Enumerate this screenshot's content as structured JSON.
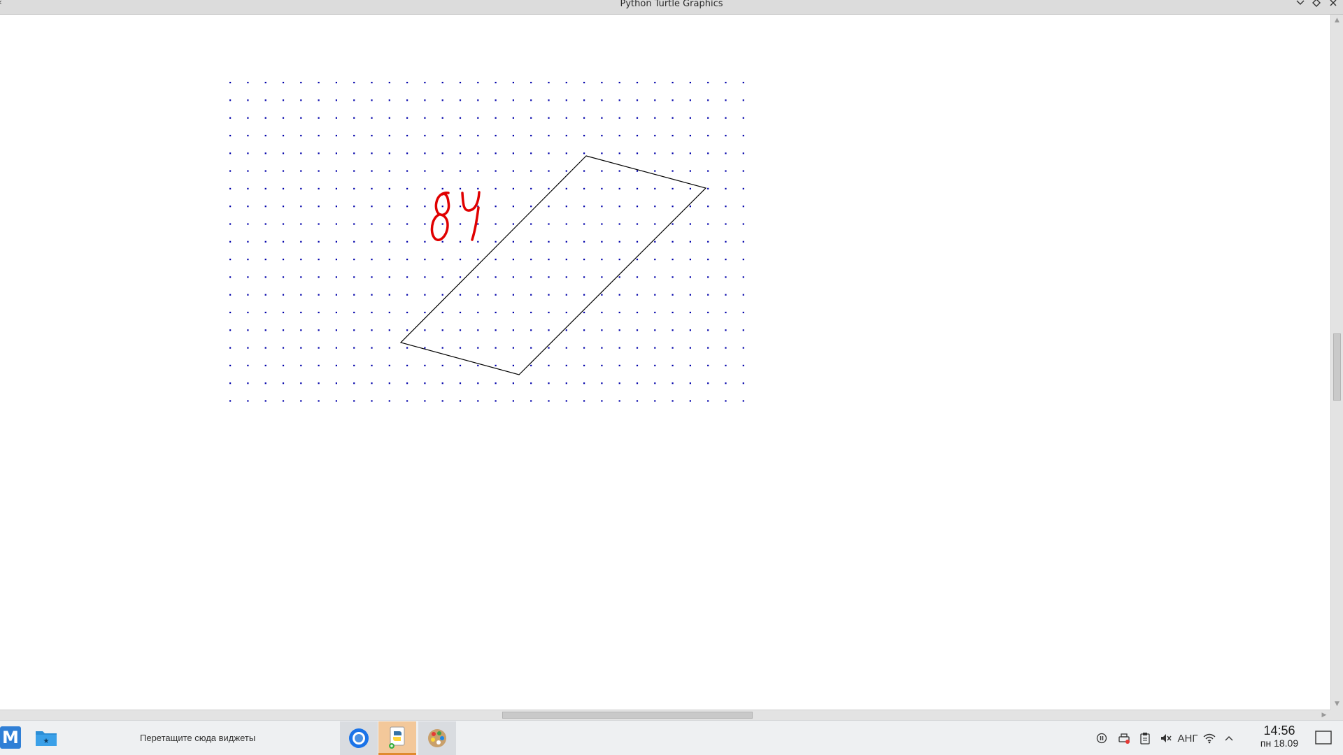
{
  "window": {
    "title": "Python Turtle Graphics",
    "controls": {
      "minimize_icon": "chevron-down-icon",
      "maximize_icon": "diamond-icon",
      "close_icon": "close-icon"
    }
  },
  "canvas": {
    "background": "#ffffff",
    "dot_color": "#0000aa",
    "dot_grid": {
      "columns": 30,
      "rows": 19
    },
    "parallelogram_color": "#000000",
    "annotation": {
      "text": "84",
      "color": "#e00000"
    }
  },
  "taskbar": {
    "start_label": "M",
    "start_color": "#2f7fd6",
    "widget_hint": "Перетащите сюда виджеты",
    "apps": [
      {
        "name": "chromium",
        "icon": "chromium-icon",
        "active": false
      },
      {
        "name": "python",
        "icon": "python-icon",
        "active": true
      },
      {
        "name": "paint",
        "icon": "palette-icon",
        "active": false
      }
    ],
    "tray": {
      "keyboard_layout": "АНГ",
      "time": "14:56",
      "date": "пн 18.09"
    }
  }
}
